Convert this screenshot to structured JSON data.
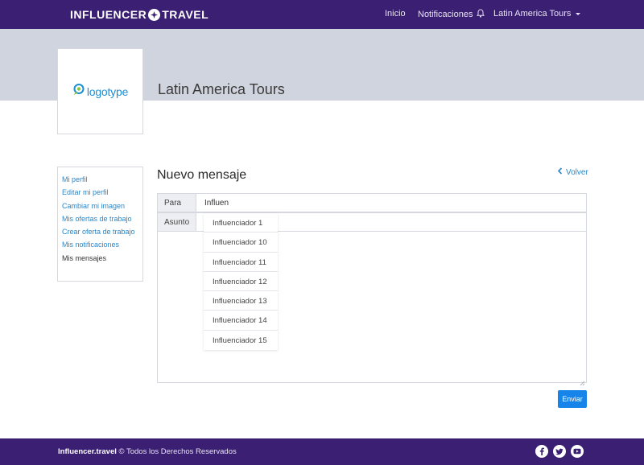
{
  "navbar": {
    "brand_left": "INFLUENCER",
    "brand_right": "TRAVEL",
    "links": {
      "home": "Inicio",
      "notifications": "Notificaciones",
      "user": "Latin America Tours"
    }
  },
  "profile": {
    "logo_text": "logotype",
    "company_name": "Latin America Tours"
  },
  "sidebar": {
    "items": [
      {
        "label": "Mi perfil"
      },
      {
        "label": "Editar mi perfil"
      },
      {
        "label": "Cambiar mi imagen"
      },
      {
        "label": "Mis ofertas de trabajo"
      },
      {
        "label": "Crear oferta de trabajo"
      },
      {
        "label": "Mis notificaciones"
      },
      {
        "label": "Mis mensajes"
      }
    ]
  },
  "compose": {
    "heading": "Nuevo mensaje",
    "back_label": "Volver",
    "to_label": "Para",
    "to_value": "Influen",
    "subject_label": "Asunto",
    "subject_value": "",
    "body_value": "",
    "send_label": "Enviar",
    "suggestions": [
      "Influenciador 1",
      "Influenciador 10",
      "Influenciador 11",
      "Influenciador 12",
      "Influenciador 13",
      "Influenciador 14",
      "Influenciador 15"
    ]
  },
  "footer": {
    "brand": "Influencer.travel",
    "rights": "© Todos los Derechos Reservados"
  },
  "colors": {
    "navbar_bg": "#3b1f73",
    "banner_bg": "#d0d4de",
    "link": "#2a87c8",
    "button": "#1684e8"
  },
  "icons": {
    "brand": "compass-icon",
    "notifications": "bell-icon",
    "user_menu": "caret-down-icon",
    "back": "chevron-left-icon",
    "logo": "speech-bubble-icon",
    "social": [
      "facebook-icon",
      "twitter-icon",
      "youtube-icon"
    ]
  }
}
